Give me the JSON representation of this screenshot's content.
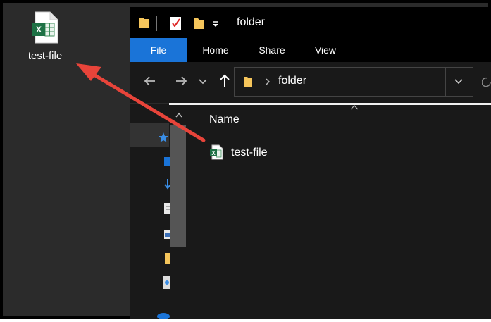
{
  "desktop": {
    "icon_label": "test-file",
    "icon": "excel-file-icon"
  },
  "explorer": {
    "window_title": "folder",
    "quick_access_icons": [
      "folder-icon",
      "properties-checklist-icon",
      "new-folder-icon",
      "customize-dropdown-icon"
    ],
    "ribbon_tabs": [
      {
        "label": "File",
        "active": true
      },
      {
        "label": "Home",
        "active": false
      },
      {
        "label": "Share",
        "active": false
      },
      {
        "label": "View",
        "active": false
      }
    ],
    "address": {
      "path": "folder",
      "icons": [
        "back-arrow-icon",
        "forward-arrow-icon",
        "recent-locations-icon",
        "up-arrow-icon",
        "folder-icon",
        "chevron-right-icon",
        "address-dropdown-icon",
        "refresh-icon"
      ]
    },
    "columns": {
      "name_header": "Name"
    },
    "files": [
      {
        "name": "test-file",
        "icon": "excel-file-icon"
      }
    ],
    "nav_icons": [
      "quick-access-star-icon",
      "desktop-icon",
      "downloads-icon",
      "documents-icon",
      "pictures-icon",
      "folder-icon",
      "disc-icon",
      "onedrive-icon"
    ]
  },
  "colors": {
    "accent": "#1a74d8",
    "annotation_arrow": "#e8443a",
    "background": "#191919"
  }
}
